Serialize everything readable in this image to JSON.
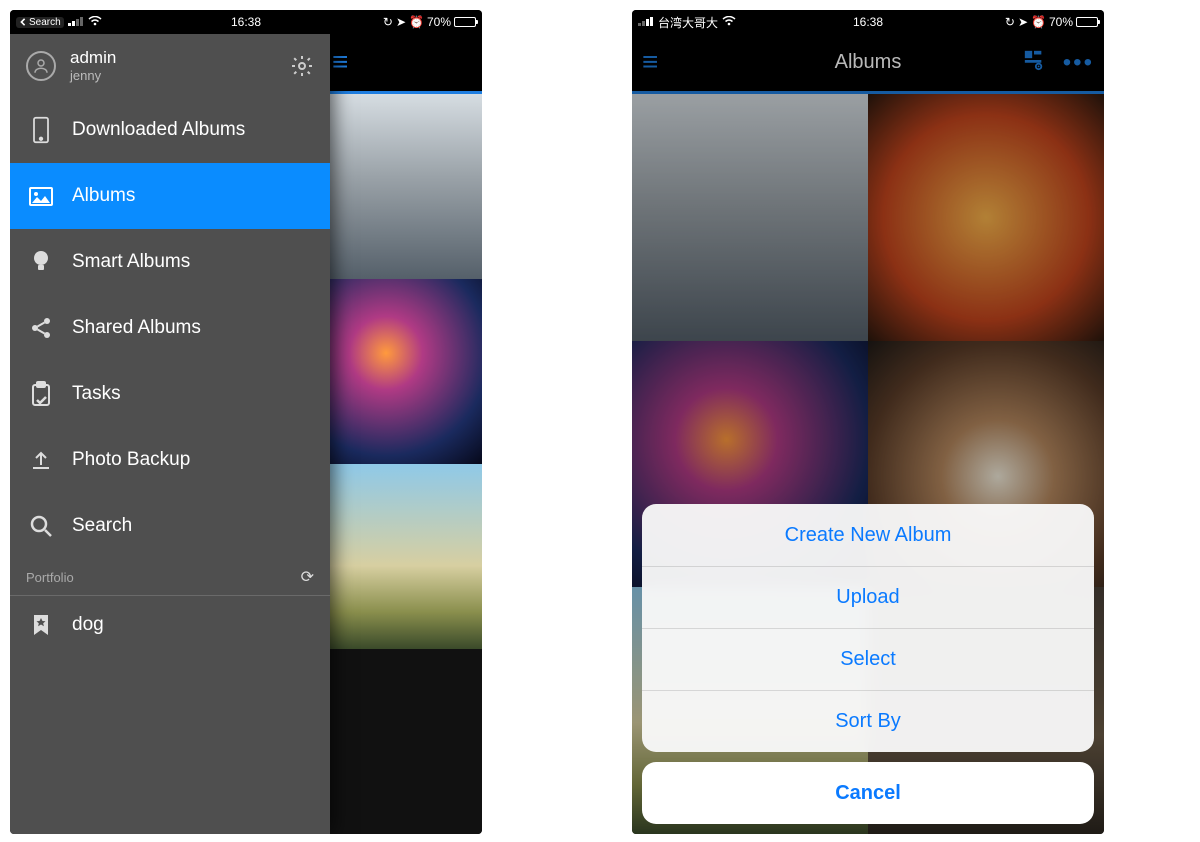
{
  "colors": {
    "accent": "#1f7ee0",
    "ios_blue": "#0a7aff",
    "sidebar_bg": "#4f4f4f",
    "active": "#0a8cff"
  },
  "phone1": {
    "statusbar": {
      "back_label": "Search",
      "carrier": "",
      "time": "16:38",
      "battery_pct": "70%",
      "battery_fill": 70
    },
    "profile": {
      "name": "admin",
      "subname": "jenny"
    },
    "nav": [
      {
        "label": "Downloaded Albums",
        "icon": "phone-icon",
        "active": false
      },
      {
        "label": "Albums",
        "icon": "albums-icon",
        "active": true
      },
      {
        "label": "Smart Albums",
        "icon": "bulb-icon",
        "active": false
      },
      {
        "label": "Shared Albums",
        "icon": "share-icon",
        "active": false
      },
      {
        "label": "Tasks",
        "icon": "clipboard-icon",
        "active": false
      },
      {
        "label": "Photo Backup",
        "icon": "upload-icon",
        "active": false
      },
      {
        "label": "Search",
        "icon": "search-icon",
        "active": false
      }
    ],
    "section_label": "Portfolio",
    "portfolio": [
      {
        "label": "dog",
        "icon": "bookmark-star-icon"
      }
    ]
  },
  "phone2": {
    "statusbar": {
      "carrier": "台湾大哥大",
      "time": "16:38",
      "battery_pct": "70%",
      "battery_fill": 70
    },
    "title": "Albums",
    "action_sheet": {
      "options": [
        "Create New Album",
        "Upload",
        "Select",
        "Sort By"
      ],
      "cancel": "Cancel"
    }
  }
}
